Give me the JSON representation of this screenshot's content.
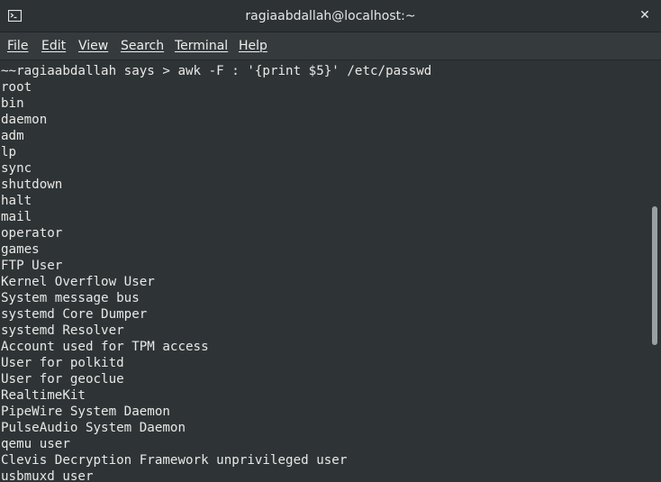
{
  "window": {
    "title": "ragiaabdallah@localhost:~",
    "close_glyph": "✕",
    "app_icon": "terminal-icon"
  },
  "menubar": {
    "items": [
      {
        "label": "File"
      },
      {
        "label": "Edit"
      },
      {
        "label": "View"
      },
      {
        "label": "Search"
      },
      {
        "label": "Terminal"
      },
      {
        "label": "Help"
      }
    ]
  },
  "terminal": {
    "lines": [
      "~~ragiaabdallah says > awk -F : '{print $5}' /etc/passwd",
      "root",
      "bin",
      "daemon",
      "adm",
      "lp",
      "sync",
      "shutdown",
      "halt",
      "mail",
      "operator",
      "games",
      "FTP User",
      "Kernel Overflow User",
      "System message bus",
      "systemd Core Dumper",
      "systemd Resolver",
      "Account used for TPM access",
      "User for polkitd",
      "User for geoclue",
      "RealtimeKit",
      "PipeWire System Daemon",
      "PulseAudio System Daemon",
      "qemu user",
      "Clevis Decryption Framework unprivileged user",
      "usbmuxd user"
    ]
  },
  "colors": {
    "background": "#2e3436",
    "foreground": "#e8e8e6",
    "titlebar": "#2d3235",
    "menubar": "#353b3d",
    "scroll_thumb": "#9aa0a2"
  }
}
